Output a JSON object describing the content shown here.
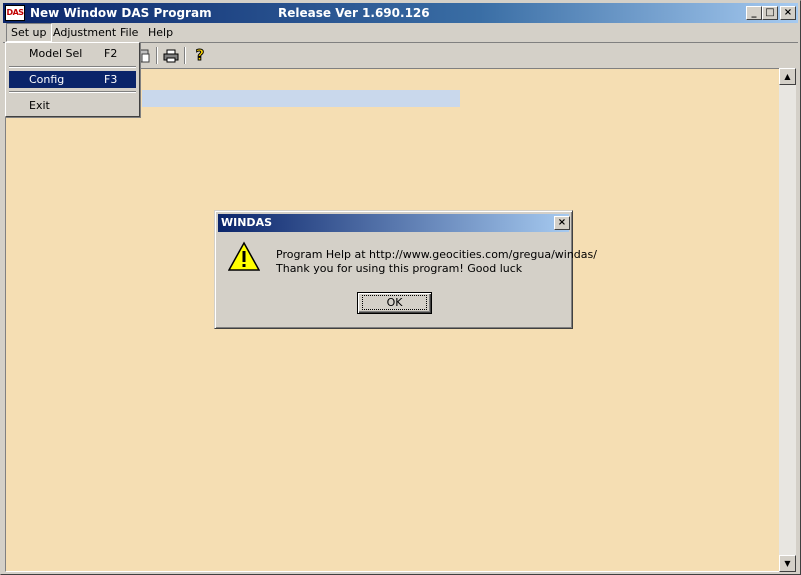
{
  "window": {
    "app_icon_text": "DAS",
    "title": "New Window DAS Program",
    "release": "Release Ver 1.690.126",
    "minimize": "_",
    "maximize": "□",
    "close": "×"
  },
  "menubar": [
    {
      "label": "Set up",
      "open": true
    },
    {
      "label": "Adjustment"
    },
    {
      "label": "File"
    },
    {
      "label": "Help"
    }
  ],
  "setup_menu": [
    {
      "label": "Model Sel",
      "shortcut": "F2",
      "selected": false
    },
    {
      "label": "Config",
      "shortcut": "F3",
      "selected": true
    },
    {
      "label": "Exit",
      "shortcut": ""
    }
  ],
  "toolbar": {
    "icons": [
      "paste-icon",
      "print-icon",
      "help-icon"
    ],
    "help_glyph": "?"
  },
  "dialog": {
    "title": "WINDAS",
    "close": "×",
    "icon": "warning-icon",
    "line1": "Program Help at http://www.geocities.com/gregua/windas/",
    "line2": "Thank you for using this program! Good luck",
    "ok_label": "OK"
  },
  "colors": {
    "client_background": "#f5deb3",
    "title_gradient_start": "#0a246a",
    "selection": "#0a246a"
  }
}
